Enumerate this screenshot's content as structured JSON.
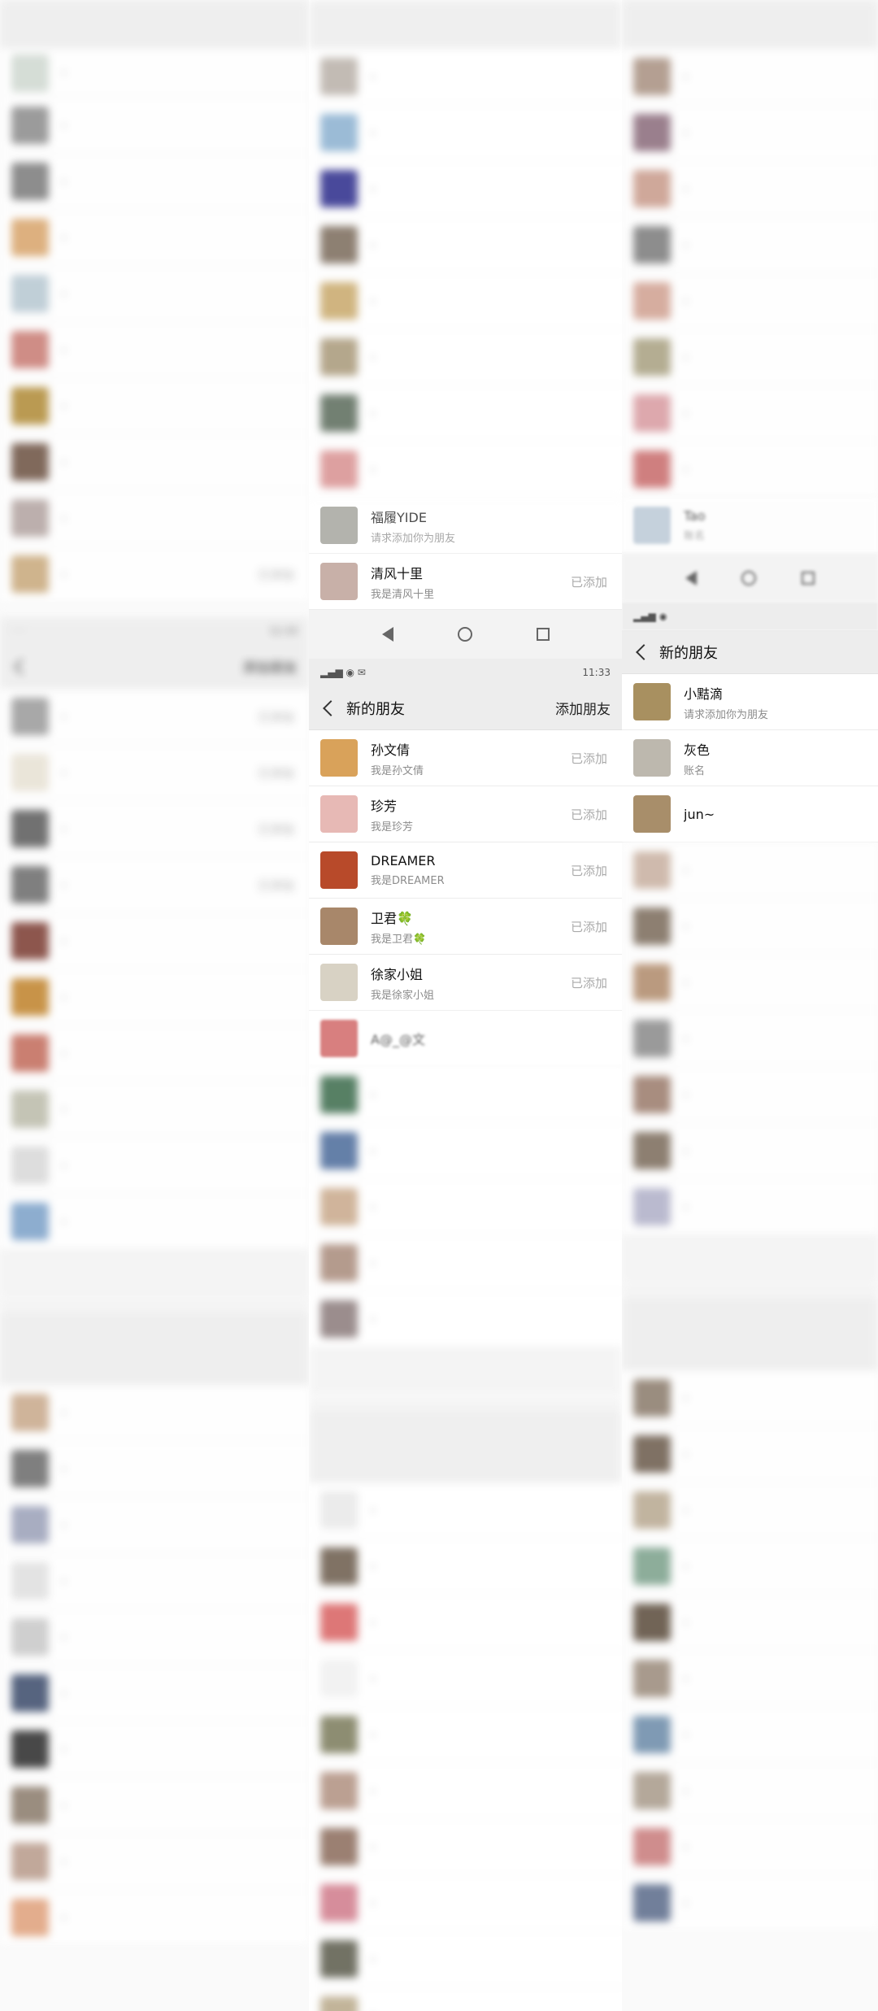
{
  "shared": {
    "time": "11:33",
    "title": "新的朋友",
    "add_friend": "添加朋友",
    "added": "已添加"
  },
  "mid_top": {
    "rows": [
      {
        "name": "福履YIDE",
        "sub": "请求添加你为朋友",
        "status": ""
      },
      {
        "name": "清风十里",
        "sub": "我是清风十里",
        "status": "已添加"
      }
    ]
  },
  "mid_main": {
    "rows": [
      {
        "name": "孙文倩",
        "sub": "我是孙文倩",
        "status": "已添加",
        "color": "#d9a25a"
      },
      {
        "name": "珍芳",
        "sub": "我是珍芳",
        "status": "已添加",
        "color": "#e7b9b5"
      },
      {
        "name": "DREAMER",
        "sub": "我是DREAMER",
        "status": "已添加",
        "color": "#b84a2a"
      },
      {
        "name": "卫君🍀",
        "sub": "我是卫君🍀",
        "status": "已添加",
        "color": "#a8876a"
      },
      {
        "name": "徐家小姐",
        "sub": "我是徐家小姐",
        "status": "已添加",
        "color": "#d8d2c4"
      },
      {
        "name": "A@_@文",
        "sub": "",
        "status": "",
        "color": "#c84a4a"
      }
    ]
  },
  "right": {
    "title": "新的朋友",
    "rows": [
      {
        "name": "小黠滴",
        "sub": "请求添加你为朋友",
        "color": "#a89060"
      },
      {
        "name": "灰色",
        "sub": "账名",
        "color": "#bdb8ae"
      },
      {
        "name": "jun~",
        "sub": "",
        "color": "#a88e6a"
      }
    ],
    "top_row": {
      "name": "Tao",
      "sub": "账名"
    }
  },
  "left": {
    "statuses": [
      "已添加",
      "已添加",
      "已添加",
      "已添加",
      "已添加"
    ]
  }
}
